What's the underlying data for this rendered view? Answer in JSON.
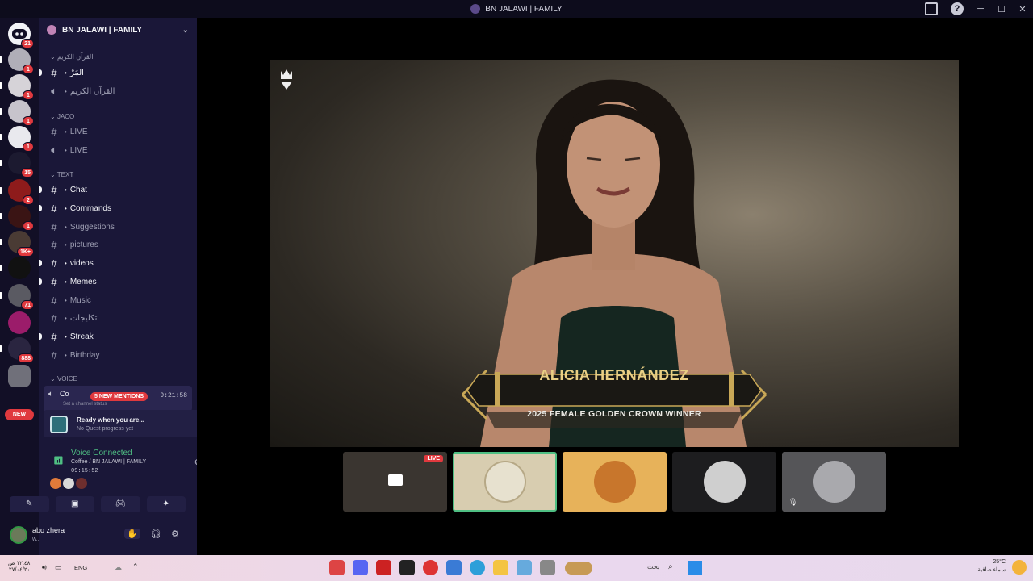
{
  "window": {
    "title": "BN JALAWI | FAMILY"
  },
  "server_list": {
    "badges": [
      "21",
      "1",
      "1",
      "1",
      "1",
      "15",
      "2",
      "1",
      "1K+",
      "71",
      "888"
    ],
    "new_label": "NEW"
  },
  "guild": {
    "name": "BN JALAWI | FAMILY"
  },
  "categories": [
    {
      "label": "القرآن الكريم",
      "channels": [
        {
          "name": "المَرْ",
          "type": "text",
          "unread": true
        },
        {
          "name": "القرآن الكريم",
          "type": "voice",
          "unread": false
        }
      ]
    },
    {
      "label": "JACO",
      "channels": [
        {
          "name": "LIVE",
          "type": "text",
          "unread": false
        },
        {
          "name": "LIVE",
          "type": "voice",
          "unread": false
        }
      ]
    },
    {
      "label": "TEXT",
      "channels": [
        {
          "name": "Chat",
          "type": "text",
          "unread": true
        },
        {
          "name": "Commands",
          "type": "text",
          "unread": true
        },
        {
          "name": "Suggestions",
          "type": "text",
          "unread": false
        },
        {
          "name": "pictures",
          "type": "text",
          "unread": false
        },
        {
          "name": "videos",
          "type": "text",
          "unread": true
        },
        {
          "name": "Memes",
          "type": "text",
          "unread": true
        },
        {
          "name": "Music",
          "type": "text",
          "unread": false
        },
        {
          "name": "تكليجات",
          "type": "text",
          "unread": false
        },
        {
          "name": "Streak",
          "type": "text",
          "unread": true
        },
        {
          "name": "Birthday",
          "type": "text",
          "unread": false
        }
      ]
    },
    {
      "label": "VOICE",
      "channels": []
    }
  ],
  "voice_channel": {
    "name": "Co",
    "mentions": "5 NEW MENTIONS",
    "timer": "9:21:58",
    "status": "Set a channel status"
  },
  "quest": {
    "title": "Ready when you are...",
    "subtitle": "No Quest progress yet"
  },
  "voice_connected": {
    "label": "Voice Connected",
    "channel": "Coffee / BN JALAWI | FAMILY",
    "time": "09:15:52"
  },
  "user": {
    "name": "abo zhera",
    "status": "w..."
  },
  "stream": {
    "banner_name": "ALICIA HERNÁNDEZ",
    "banner_sub": "2025 FEMALE GOLDEN CROWN WINNER",
    "live_label": "LIVE"
  },
  "taskbar": {
    "time": "١٢:٤٨ ص",
    "date": "٢٧/٠٤/٢٠",
    "lang": "ENG",
    "search": "بحث",
    "temp": "25°C",
    "weather": "سماء صافية"
  },
  "colors": {
    "accent_green": "#4fbf83",
    "mention_red": "#e0393e",
    "sidebar": "#1a1738",
    "rail": "#120f26"
  }
}
